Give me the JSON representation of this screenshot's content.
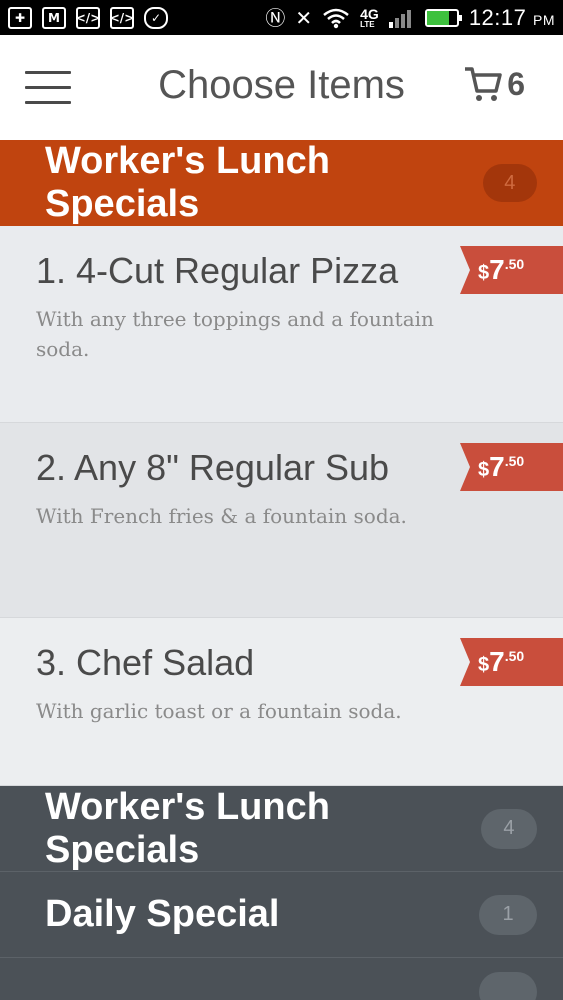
{
  "status_bar": {
    "network": "4G",
    "network_sub": "LTE",
    "battery_level": 0.75,
    "time": "12:17",
    "ampm": "PM",
    "left_icons": [
      "add-notification-icon",
      "gmail-icon",
      "code-icon",
      "code-icon",
      "chat-check-icon"
    ],
    "right_icons": [
      "nfc-icon",
      "mute-icon",
      "wifi-icon",
      "signal-icon",
      "battery-icon"
    ]
  },
  "header": {
    "title": "Choose Items",
    "cart_count": "6"
  },
  "category": {
    "title": "Worker's Lunch Specials",
    "count": "4"
  },
  "items": [
    {
      "title": "1.  4-Cut Regular Pizza",
      "description": "With any three toppings and a fountain soda.",
      "price_symbol": "$",
      "price_whole": "7",
      "price_cents": ".50"
    },
    {
      "title": "2.  Any 8\" Regular Sub",
      "description": "With French fries & a fountain soda.",
      "price_symbol": "$",
      "price_whole": "7",
      "price_cents": ".50"
    },
    {
      "title": "3.  Chef Salad",
      "description": "With garlic toast or a fountain soda.",
      "price_symbol": "$",
      "price_whole": "7",
      "price_cents": ".50"
    }
  ],
  "nav": [
    {
      "label": "Worker's Lunch Specials",
      "count": "4"
    },
    {
      "label": "Daily Special",
      "count": "1"
    }
  ],
  "colors": {
    "category_bg": "#c0440f",
    "price_tag": "#c94e3c",
    "nav_bg": "#4b5157"
  }
}
